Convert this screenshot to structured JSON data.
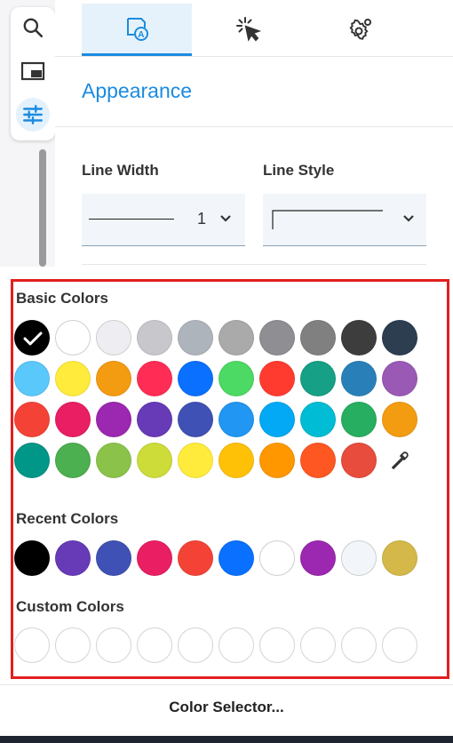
{
  "tabs": [
    {
      "name": "appearance",
      "icon": "shape-text-icon",
      "active": true
    },
    {
      "name": "interaction",
      "icon": "cursor-click-icon",
      "active": false
    },
    {
      "name": "settings",
      "icon": "gear-icon",
      "active": false
    }
  ],
  "toolbar": {
    "tools": [
      "search-icon",
      "panel-icon",
      "sliders-icon"
    ]
  },
  "appearance": {
    "title": "Appearance",
    "line_width_label": "Line Width",
    "line_width_value": "1",
    "line_style_label": "Line Style"
  },
  "colors": {
    "basic_label": "Basic Colors",
    "recent_label": "Recent Colors",
    "custom_label": "Custom Colors",
    "selected_basic": "#000000",
    "basic": [
      [
        "#000000",
        "#ffffff",
        "#eeeef2",
        "#c7c7cc",
        "#aeb4bb",
        "#aaaaaa",
        "#8e8e93",
        "#808080",
        "#3d3d3d",
        "#2c3e50"
      ],
      [
        "#5ac8fa",
        "#ffeb3b",
        "#f39c12",
        "#ff2d55",
        "#0a70ff",
        "#4cd964",
        "#ff3b30",
        "#16a085",
        "#2980b9",
        "#9b59b6"
      ],
      [
        "#f44336",
        "#e91e63",
        "#9c27b0",
        "#673ab7",
        "#3f51b5",
        "#2196f3",
        "#03a9f4",
        "#00bcd4",
        "#27ae60",
        "#f39c12"
      ],
      [
        "#009688",
        "#4caf50",
        "#8bc34a",
        "#cddc39",
        "#ffeb3b",
        "#ffc107",
        "#ff9800",
        "#ff5722",
        "#e74c3c"
      ]
    ],
    "recent": [
      "#000000",
      "#673ab7",
      "#3f51b5",
      "#e91e63",
      "#f44336",
      "#0a70ff",
      "#ffffff",
      "#9c27b0",
      "#f2f6fa",
      "#d4b84a"
    ],
    "custom": [
      "",
      "",
      "",
      "",
      "",
      "",
      "",
      "",
      "",
      ""
    ]
  },
  "footer": {
    "button_label": "Color Selector..."
  }
}
